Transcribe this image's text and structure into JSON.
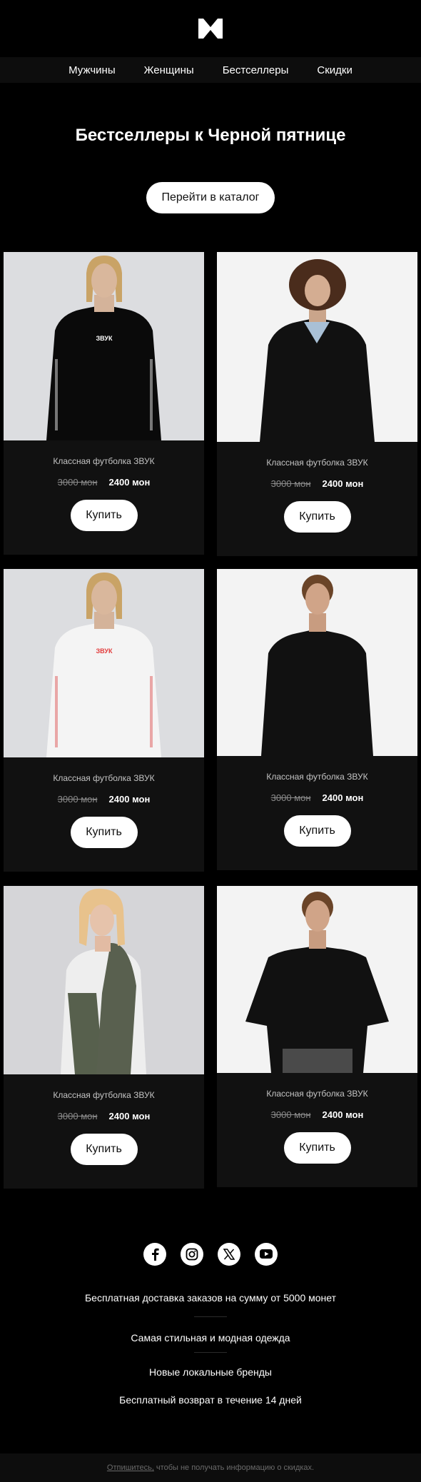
{
  "nav": {
    "items": [
      "Мужчины",
      "Женщины",
      "Бестселлеры",
      "Скидки"
    ]
  },
  "hero": {
    "title": "Бестселлеры к Черной пятнице",
    "catalog_label": "Перейти в каталог"
  },
  "products": [
    {
      "name": "Классная футболка ЗВУК",
      "old_price": "3000 мон",
      "new_price": "2400 мон",
      "buy_label": "Купить",
      "print_text": "ЗВУК"
    },
    {
      "name": "Классная футболка ЗВУК",
      "old_price": "3000 мон",
      "new_price": "2400 мон",
      "buy_label": "Купить"
    },
    {
      "name": "Классная футболка ЗВУК",
      "old_price": "3000 мон",
      "new_price": "2400 мон",
      "buy_label": "Купить",
      "print_text": "ЗВУК"
    },
    {
      "name": "Классная футболка ЗВУК",
      "old_price": "3000 мон",
      "new_price": "2400 мон",
      "buy_label": "Купить"
    },
    {
      "name": "Классная футболка ЗВУК",
      "old_price": "3000 мон",
      "new_price": "2400 мон",
      "buy_label": "Купить"
    },
    {
      "name": "Классная футболка ЗВУК",
      "old_price": "3000 мон",
      "new_price": "2400 мон",
      "buy_label": "Купить"
    }
  ],
  "socials": [
    "facebook-icon",
    "instagram-icon",
    "x-icon",
    "youtube-icon"
  ],
  "footer": {
    "line1": "Бесплатная доставка заказов на сумму от 5000 монет",
    "line2": "Самая стильная и модная одежда",
    "line3": "Новые локальные бренды",
    "line4": "Бесплатный возврат в течение 14 дней"
  },
  "unsubscribe": {
    "link": "Отпишитесь,",
    "text": " чтобы не получать информацию о скидках."
  },
  "colors": {
    "background": "#000000",
    "card": "#111111",
    "nav": "#0d0d0d",
    "button": "#ffffff"
  }
}
